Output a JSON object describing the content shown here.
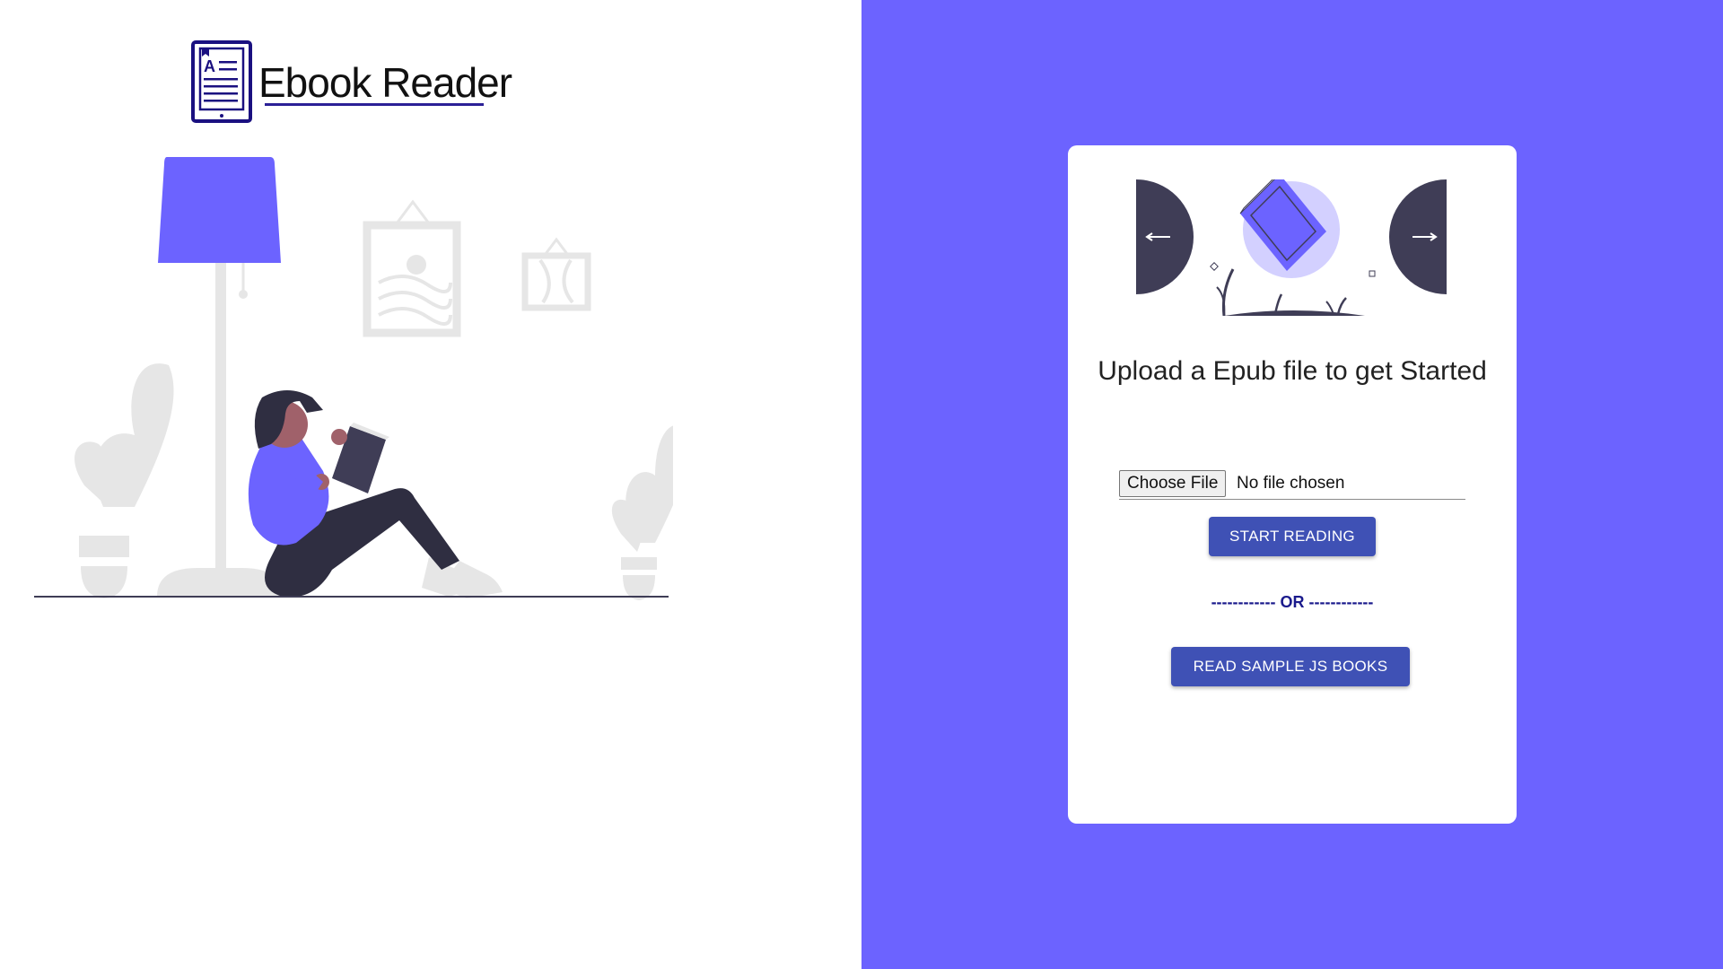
{
  "brand": {
    "name": "Ebook Reader",
    "logo_icon": "ebook-tablet-icon",
    "logo_letter": "A"
  },
  "hero": {
    "illustration": "woman-reading-under-floor-lamp"
  },
  "upload_card": {
    "illustration": "book-with-arrows",
    "title": "Upload a Epub file to get Started",
    "file_input": {
      "button_label": "Choose File",
      "status": "No file chosen"
    },
    "start_button": "START READING",
    "divider": "------------ OR ------------",
    "sample_button": "READ SAMPLE JS BOOKS"
  },
  "colors": {
    "accent": "#6c63ff",
    "button": "#3f51b5",
    "dark": "#3f3d56",
    "brand_blue": "#2b2096",
    "background": "#ffffff",
    "ghost": "#e6e6e6"
  }
}
